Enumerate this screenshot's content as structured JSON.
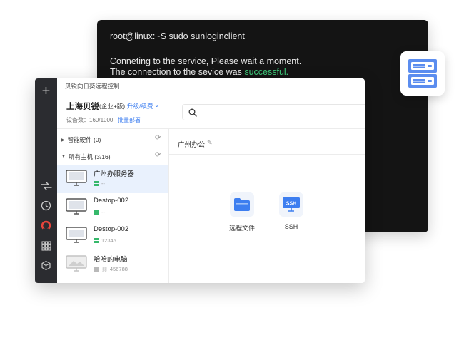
{
  "terminal": {
    "command_line": "root@linux:~S sudo sunloginclient",
    "line2": "Conneting to the service, Please wait a moment.",
    "line3_prefix": "The connection to the sevice was ",
    "line3_status": "successful."
  },
  "app": {
    "title": "贝锐向日葵远程控制",
    "org": {
      "name": "上海贝锐",
      "edition": "(企业+版)",
      "upgrade_link": "升级/续费",
      "device_count": "设备数：160/1000",
      "batch_link": "批量部署"
    },
    "search": {
      "placeholder": ""
    },
    "groups": [
      {
        "label": "智能硬件 (0)",
        "expanded": false
      },
      {
        "label": "所有主机 (3/16)",
        "expanded": true
      }
    ],
    "hosts": [
      {
        "name": "广州办服务器",
        "sub": "--",
        "os": "windows",
        "online": true,
        "active": true
      },
      {
        "name": "Destop-002",
        "sub": "--",
        "os": "windows",
        "online": true,
        "active": false
      },
      {
        "name": "Destop-002",
        "sub": "12345",
        "os": "windows",
        "online": true,
        "active": false
      },
      {
        "name": "哈哈的电脑",
        "sub": "456788",
        "os": "windows",
        "online": false,
        "active": false
      }
    ],
    "detail": {
      "title": "广州办公",
      "tools": [
        {
          "label": "远程文件",
          "icon": "folder-icon"
        },
        {
          "label": "SSH",
          "icon": "ssh-monitor-icon"
        }
      ]
    },
    "rail_icons": [
      "plus-icon",
      "remote-control-icon",
      "history-icon",
      "sunlogin-logo-icon",
      "apps-grid-icon",
      "cube-icon"
    ]
  },
  "colors": {
    "terminal_bg": "#141414",
    "success": "#3ec97a",
    "rail_bg": "#2b2c30",
    "accent": "#3d7ef0",
    "active_row": "#e9f1fd",
    "brand_red": "#e8453c"
  }
}
